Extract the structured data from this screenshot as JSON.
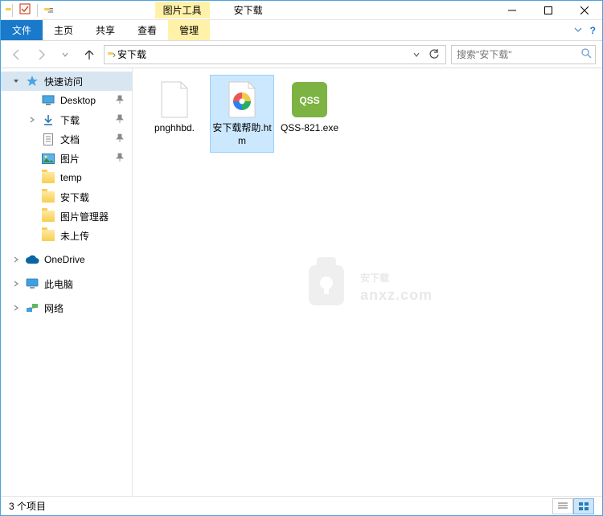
{
  "titlebar": {
    "contextual_label": "图片工具",
    "title": "安下载"
  },
  "ribbon": {
    "file": "文件",
    "home": "主页",
    "share": "共享",
    "view": "查看",
    "manage": "管理"
  },
  "breadcrumb": {
    "current": "安下载"
  },
  "search": {
    "placeholder": "搜索\"安下载\""
  },
  "sidebar": {
    "quick_access": "快速访问",
    "items": [
      {
        "label": "Desktop",
        "icon": "desktop",
        "pinned": true
      },
      {
        "label": "下载",
        "icon": "downloads",
        "pinned": true
      },
      {
        "label": "文档",
        "icon": "documents",
        "pinned": true
      },
      {
        "label": "图片",
        "icon": "pictures",
        "pinned": true
      },
      {
        "label": "temp",
        "icon": "folder",
        "pinned": false
      },
      {
        "label": "安下载",
        "icon": "folder",
        "pinned": false
      },
      {
        "label": "图片管理器",
        "icon": "folder",
        "pinned": false
      },
      {
        "label": "未上传",
        "icon": "folder",
        "pinned": false
      }
    ],
    "onedrive": "OneDrive",
    "thispc": "此电脑",
    "network": "网络"
  },
  "files": [
    {
      "name": "pnghhbd.",
      "type": "blank",
      "selected": false
    },
    {
      "name": "安下载帮助.htm",
      "type": "htm",
      "selected": true
    },
    {
      "name": "QSS-821.exe",
      "type": "qss",
      "selected": false
    }
  ],
  "watermark": {
    "line1": "安下载",
    "line2": "anxz.com"
  },
  "statusbar": {
    "text": "3 个项目"
  }
}
